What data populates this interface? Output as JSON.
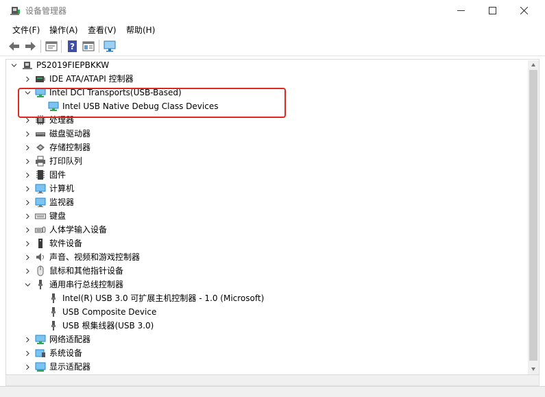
{
  "window": {
    "title": "设备管理器"
  },
  "menu": {
    "items": [
      {
        "label": "文件(F)"
      },
      {
        "label": "操作(A)"
      },
      {
        "label": "查看(V)"
      },
      {
        "label": "帮助(H)"
      }
    ]
  },
  "toolbar": {
    "buttons": [
      "back-arrow-icon",
      "forward-arrow-icon",
      "properties-icon",
      "help-icon",
      "details-view-icon",
      "monitor-scan-icon"
    ]
  },
  "tree": {
    "root": "PS2019FIEPBKKW",
    "rows": [
      {
        "label": "IDE ATA/ATAPI 控制器",
        "expanded": false,
        "icon": "ide-controller-icon"
      },
      {
        "label": "Intel DCI Transports(USB-Based)",
        "expanded": true,
        "icon": "network-adapter-icon"
      },
      {
        "label": "Intel USB Native Debug Class Devices",
        "icon": "network-adapter-icon"
      },
      {
        "label": "处理器",
        "expanded": false,
        "icon": "processor-icon"
      },
      {
        "label": "磁盘驱动器",
        "expanded": false,
        "icon": "disk-drive-icon"
      },
      {
        "label": "存储控制器",
        "expanded": false,
        "icon": "storage-controller-icon"
      },
      {
        "label": "打印队列",
        "expanded": false,
        "icon": "printer-icon"
      },
      {
        "label": "固件",
        "expanded": false,
        "icon": "firmware-icon"
      },
      {
        "label": "计算机",
        "expanded": false,
        "icon": "computer-icon"
      },
      {
        "label": "监视器",
        "expanded": false,
        "icon": "monitor-icon"
      },
      {
        "label": "键盘",
        "expanded": false,
        "icon": "keyboard-icon"
      },
      {
        "label": "人体学输入设备",
        "expanded": false,
        "icon": "hid-icon"
      },
      {
        "label": "软件设备",
        "expanded": false,
        "icon": "software-device-icon"
      },
      {
        "label": "声音、视频和游戏控制器",
        "expanded": false,
        "icon": "speaker-icon"
      },
      {
        "label": "鼠标和其他指针设备",
        "expanded": false,
        "icon": "mouse-icon"
      },
      {
        "label": "通用串行总线控制器",
        "expanded": true,
        "icon": "usb-icon"
      },
      {
        "label": "Intel(R) USB 3.0 可扩展主机控制器 - 1.0 (Microsoft)",
        "icon": "usb-icon"
      },
      {
        "label": "USB Composite Device",
        "icon": "usb-icon"
      },
      {
        "label": "USB 根集线器(USB 3.0)",
        "icon": "usb-icon"
      },
      {
        "label": "网络适配器",
        "expanded": false,
        "icon": "network-adapter-icon"
      },
      {
        "label": "系统设备",
        "expanded": false,
        "icon": "system-device-icon"
      },
      {
        "label": "显示适配器",
        "expanded": false,
        "icon": "display-adapter-icon"
      }
    ]
  },
  "colors": {
    "highlight": "#e0261f",
    "icon_blue": "#1e88d6",
    "icon_green": "#2fa84f"
  }
}
